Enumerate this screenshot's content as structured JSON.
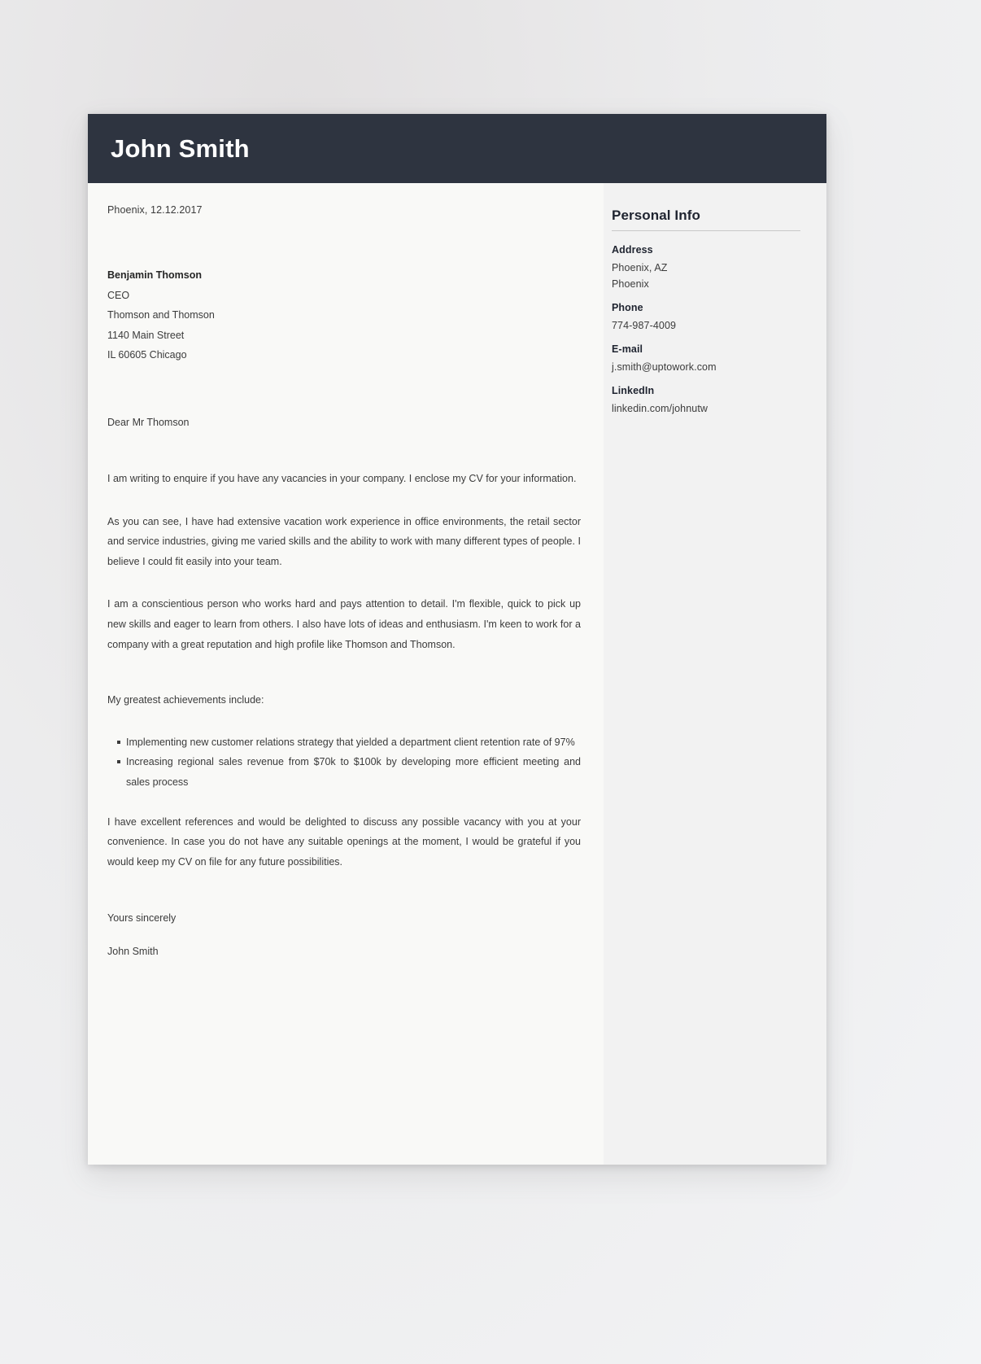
{
  "header": {
    "name": "John Smith"
  },
  "letter": {
    "date": "Phoenix, 12.12.2017",
    "recipient": {
      "name": "Benjamin Thomson",
      "title": "CEO",
      "company": "Thomson and Thomson",
      "street": "1140 Main Street",
      "city_line": "IL 60605 Chicago"
    },
    "salutation": "Dear Mr Thomson",
    "paragraphs": [
      "I am writing to enquire if you have any vacancies in your company. I enclose my CV for your information.",
      "As you can see, I have had extensive vacation work experience in office environments, the retail sector and service industries, giving me varied skills and the ability to work with many different types of people. I believe I could fit easily into your team.",
      "I am a conscientious person who works hard and pays attention to detail. I'm flexible, quick to pick up new skills and eager to learn from others. I also have lots of ideas and enthusiasm. I'm keen to work for a company with a great reputation and high profile like Thomson and Thomson."
    ],
    "achievements_intro": "My greatest achievements include:",
    "achievements": [
      "Implementing new customer relations strategy that yielded a department client retention rate of 97%",
      "Increasing regional sales revenue from $70k to $100k by developing more efficient meeting and sales process"
    ],
    "closing_paragraph": "I have excellent references and would be delighted to discuss any possible vacancy with you at your convenience. In case you do not have any suitable openings at the moment, I would be grateful if you would keep my CV on file for any future possibilities.",
    "signoff": "Yours sincerely",
    "signature": "John Smith"
  },
  "sidebar": {
    "title": "Personal Info",
    "groups": [
      {
        "label": "Address",
        "lines": [
          "Phoenix, AZ",
          "Phoenix"
        ]
      },
      {
        "label": "Phone",
        "lines": [
          "774-987-4009"
        ]
      },
      {
        "label": "E-mail",
        "lines": [
          "j.smith@uptowork.com"
        ]
      },
      {
        "label": "LinkedIn",
        "lines": [
          "linkedin.com/johnutw"
        ]
      }
    ]
  },
  "colors": {
    "header_band": "#2e3440",
    "page": "#ffffff",
    "letter_column": "#f9f9f7",
    "sidebar_column": "#f2f2f2",
    "text": "#3b3b3b",
    "heading": "#1f2430",
    "rule": "#c9c9c9"
  }
}
